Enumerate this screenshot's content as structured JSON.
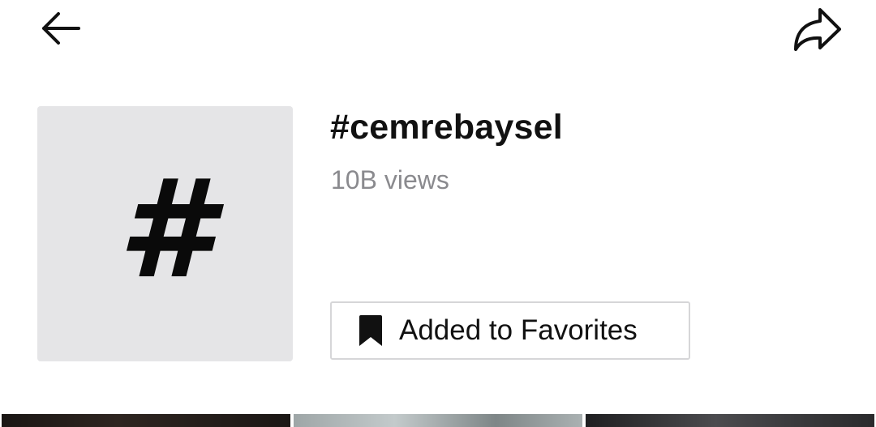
{
  "header": {
    "back_icon": "arrow-left-icon",
    "share_icon": "share-arrow-icon"
  },
  "hashtag": {
    "symbol": "#",
    "title": "#cemrebaysel",
    "views": "10B views"
  },
  "favorites": {
    "icon": "bookmark-icon",
    "label": "Added to Favorites"
  },
  "videos": [
    {
      "name": "video-1"
    },
    {
      "name": "video-2"
    },
    {
      "name": "video-3"
    }
  ]
}
